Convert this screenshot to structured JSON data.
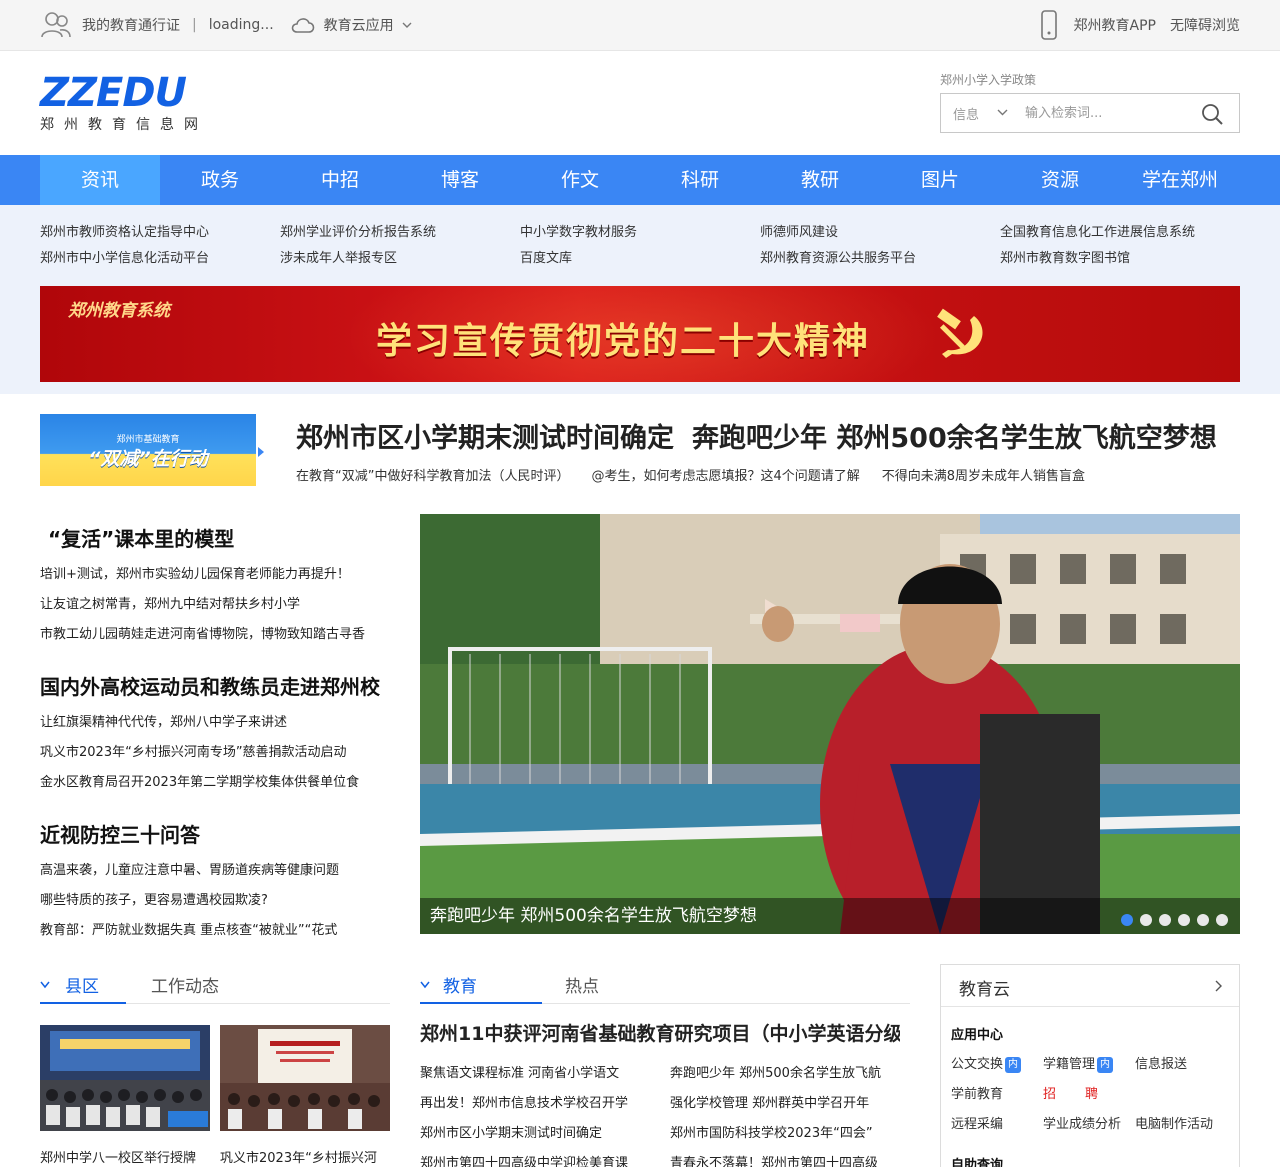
{
  "topbar": {
    "pass_label": "我的教育通行证",
    "loading_label": "loading...",
    "cloud_apps_label": "教育云应用",
    "app_label": "郑州教育APP",
    "accessibility_label": "无障碍浏览"
  },
  "logo": {
    "word": "ZZEDU",
    "subtitle": "郑州教育信息网"
  },
  "search": {
    "policy_link": "郑州小学入学政策",
    "category": "信息",
    "placeholder": "输入检索词..."
  },
  "nav": {
    "items": [
      "资讯",
      "政务",
      "中招",
      "博客",
      "作文",
      "科研",
      "教研",
      "图片",
      "资源",
      "学在郑州"
    ]
  },
  "quick_links": {
    "row1": [
      "郑州市教师资格认定指导中心",
      "郑州学业评价分析报告系统",
      "中小学数字教材服务",
      "师德师风建设",
      "全国教育信息化工作进展信息系统"
    ],
    "row2": [
      "郑州市中小学信息化活动平台",
      "涉未成年人举报专区",
      "百度文库",
      "郑州教育资源公共服务平台",
      "郑州市教育数字图书馆"
    ]
  },
  "banner": {
    "brand": "郑州教育系统",
    "slogan": "学习宣传贯彻党的二十大精神"
  },
  "promo": {
    "small": "郑州市基础教育",
    "big": "“双减”在行动"
  },
  "headline": {
    "titles": [
      "郑州市区小学期末测试时间确定",
      "奔跑吧少年 郑州500余名学生放飞航空梦想"
    ],
    "subs": [
      "在教育“双减”中做好科学教育加法（人民时评）",
      "@考生，如何考虑志愿填报？这4个问题请了解",
      "不得向未满8周岁未成年人销售盲盒"
    ]
  },
  "stories": [
    {
      "title": "“复活”课本里的模型",
      "lines": [
        "培训+测试，郑州市实验幼儿园保育老师能力再提升！",
        "让友谊之树常青，郑州九中结对帮扶乡村小学",
        "市教工幼儿园萌娃走进河南省博物院，博物致知踏古寻香"
      ]
    },
    {
      "title": "国内外高校运动员和教练员走进郑州校",
      "lines": [
        "让红旗渠精神代代传，郑州八中学子来讲述",
        "巩义市2023年“乡村振兴河南专场”慈善捐款活动启动",
        "金水区教育局召开2023年第二学期学校集体供餐单位食"
      ]
    },
    {
      "title": "近视防控三十问答",
      "lines": [
        "高温来袭，儿童应注意中暑、胃肠道疾病等健康问题",
        "哪些特质的孩子，更容易遭遇校园欺凌?",
        "教育部：严防就业数据失真 重点核查“被就业”“花式"
      ]
    }
  ],
  "slideshow": {
    "caption": "奔跑吧少年 郑州500余名学生放飞航空梦想",
    "total": 6,
    "current": 1
  },
  "county": {
    "tabs": [
      "县区",
      "工作动态"
    ],
    "thumbs": [
      "郑州中学八一校区举行授牌",
      "巩义市2023年“乡村振兴河"
    ]
  },
  "education": {
    "tabs": [
      "教育",
      "热点"
    ],
    "title": "郑州11中获评河南省基础教育研究项目（中小学英语分级",
    "left": [
      "聚焦语文课程标准 河南省小学语文",
      "再出发！郑州市信息技术学校召开学",
      "郑州市区小学期末测试时间确定",
      "郑州市第四十四高级中学迎检美育课"
    ],
    "right": [
      "奔跑吧少年 郑州500余名学生放飞航",
      "强化学校管理 郑州群英中学召开年",
      "郑州市国防科技学校2023年“四会”",
      "青春永不落幕！郑州市第四十四高级"
    ]
  },
  "edu_cloud": {
    "title": "教育云",
    "app_center": "应用中心",
    "row1": [
      "公文交换",
      "学籍管理",
      "信息报送"
    ],
    "inner_badge": "内",
    "row2": [
      "学前教育",
      "招",
      "聘"
    ],
    "row3": [
      "远程采编",
      "学业成绩分析",
      "电脑制作活动"
    ],
    "self_query": "自助查询"
  },
  "colors": {
    "nav": "#3a86f4",
    "nav_active": "#4aa6ff",
    "brand_blue": "#1261e3",
    "banner_red": "#d8171a"
  }
}
